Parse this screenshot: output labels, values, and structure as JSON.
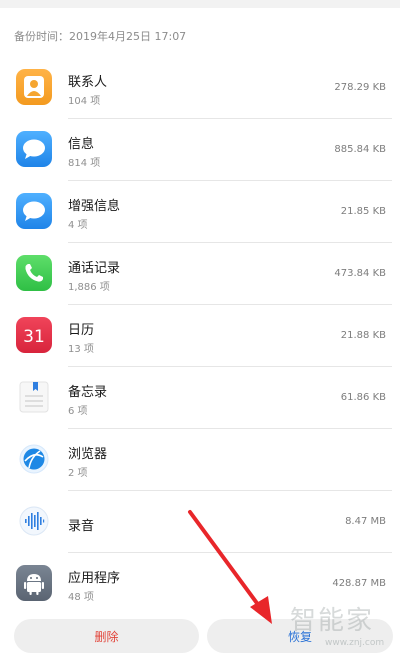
{
  "header": {
    "backup_time": "备份时间：2019年4月25日 17:07"
  },
  "items": [
    {
      "name": "联系人",
      "count": "104 项",
      "size": "278.29 KB",
      "icon": "contacts-icon"
    },
    {
      "name": "信息",
      "count": "814 项",
      "size": "885.84 KB",
      "icon": "messages-icon"
    },
    {
      "name": "增强信息",
      "count": "4 项",
      "size": "21.85 KB",
      "icon": "enhanced-messages-icon"
    },
    {
      "name": "通话记录",
      "count": "1,886 项",
      "size": "473.84 KB",
      "icon": "phone-icon"
    },
    {
      "name": "日历",
      "count": "13 项",
      "size": "21.88 KB",
      "icon": "calendar-icon",
      "icon_text": "31"
    },
    {
      "name": "备忘录",
      "count": "6 项",
      "size": "61.86 KB",
      "icon": "notepad-icon"
    },
    {
      "name": "浏览器",
      "count": "2 项",
      "size": "",
      "icon": "browser-icon"
    },
    {
      "name": "录音",
      "count": "",
      "size": "8.47 MB",
      "icon": "recorder-icon"
    },
    {
      "name": "应用程序",
      "count": "48 项",
      "size": "428.87 MB",
      "icon": "android-icon"
    }
  ],
  "buttons": {
    "delete_label": "删除",
    "restore_label": "恢复"
  },
  "watermark": {
    "text": "智能家",
    "url": "www.znj.com"
  },
  "colors": {
    "delete": "#e2443a",
    "restore": "#2a72d6",
    "arrow": "#e8262a"
  }
}
